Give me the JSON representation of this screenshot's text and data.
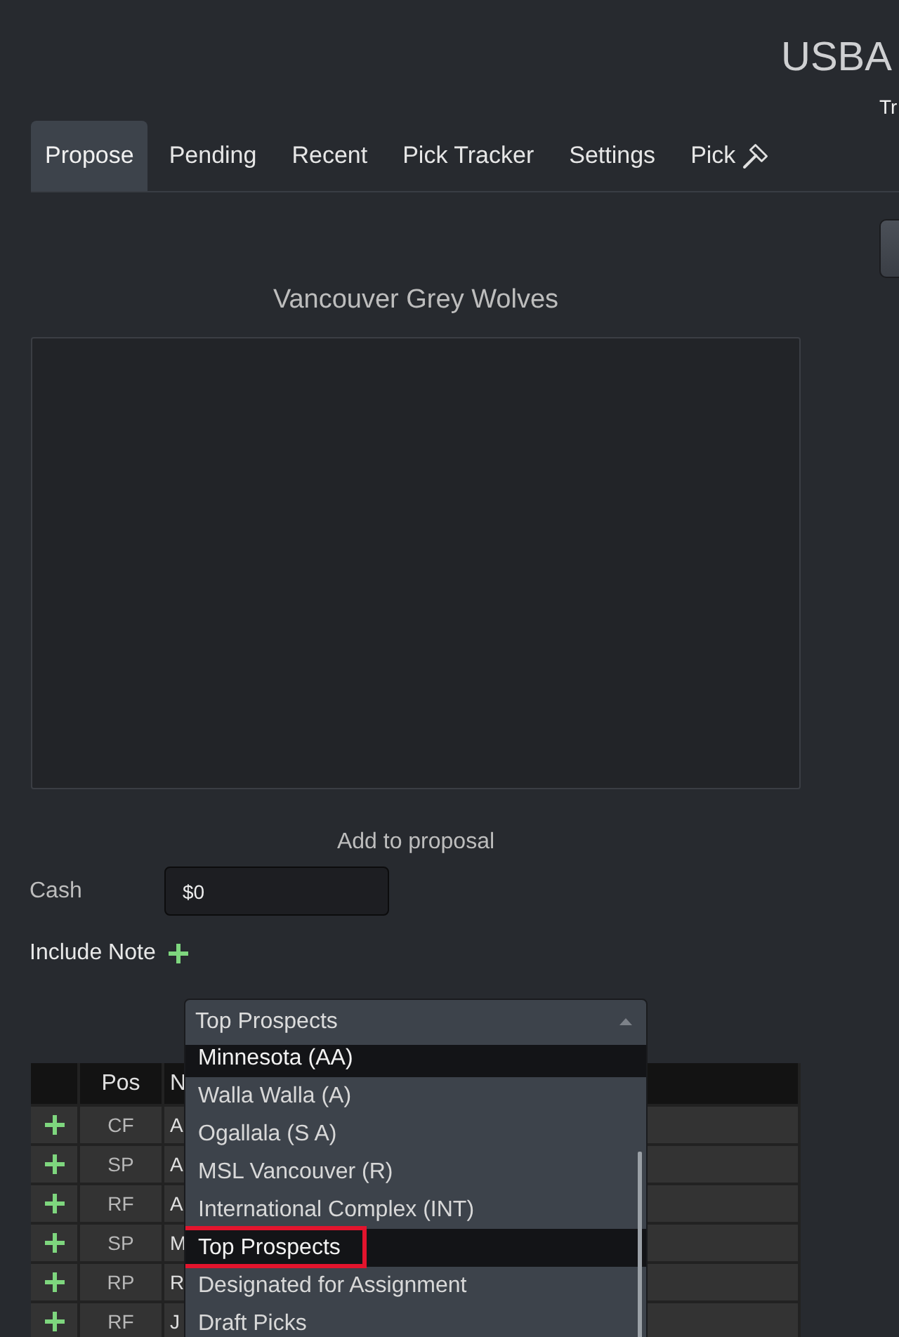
{
  "header": {
    "title": "USBA",
    "subtitle": "Tr"
  },
  "tabs": [
    {
      "label": "Propose",
      "selected": true,
      "kind": "plain"
    },
    {
      "label": "Pending",
      "selected": false,
      "kind": "plain"
    },
    {
      "label": "Recent",
      "selected": false,
      "kind": "plain"
    },
    {
      "label": "Pick Tracker",
      "selected": false,
      "kind": "plain"
    },
    {
      "label": "Settings",
      "selected": false,
      "kind": "plain"
    },
    {
      "label": "Pick",
      "selected": false,
      "kind": "tool"
    }
  ],
  "team": {
    "name": "Vancouver Grey Wolves"
  },
  "add_section": {
    "heading": "Add to proposal",
    "cash": {
      "label": "Cash",
      "value": "$0"
    },
    "note": {
      "label": "Include Note"
    }
  },
  "filter": {
    "value": "Top Prospects",
    "expanded": true,
    "options": [
      {
        "label": "Minnesota (AA)",
        "highlighted": true,
        "outlined": false
      },
      {
        "label": "Walla Walla (A)",
        "highlighted": false,
        "outlined": false
      },
      {
        "label": "Ogallala (S A)",
        "highlighted": false,
        "outlined": false
      },
      {
        "label": "MSL Vancouver (R)",
        "highlighted": false,
        "outlined": false
      },
      {
        "label": "International Complex (INT)",
        "highlighted": false,
        "outlined": false
      },
      {
        "label": "Top Prospects",
        "highlighted": true,
        "outlined": true
      },
      {
        "label": "Designated for Assignment",
        "highlighted": false,
        "outlined": false
      },
      {
        "label": "Draft Picks",
        "highlighted": false,
        "outlined": false
      }
    ]
  },
  "table": {
    "columns": [
      "Pos",
      "N"
    ],
    "rows": [
      {
        "pos": "CF",
        "name": "A"
      },
      {
        "pos": "SP",
        "name": "A"
      },
      {
        "pos": "RF",
        "name": "A"
      },
      {
        "pos": "SP",
        "name": "M"
      },
      {
        "pos": "RP",
        "name": "R"
      },
      {
        "pos": "RF",
        "name": "J"
      }
    ]
  }
}
